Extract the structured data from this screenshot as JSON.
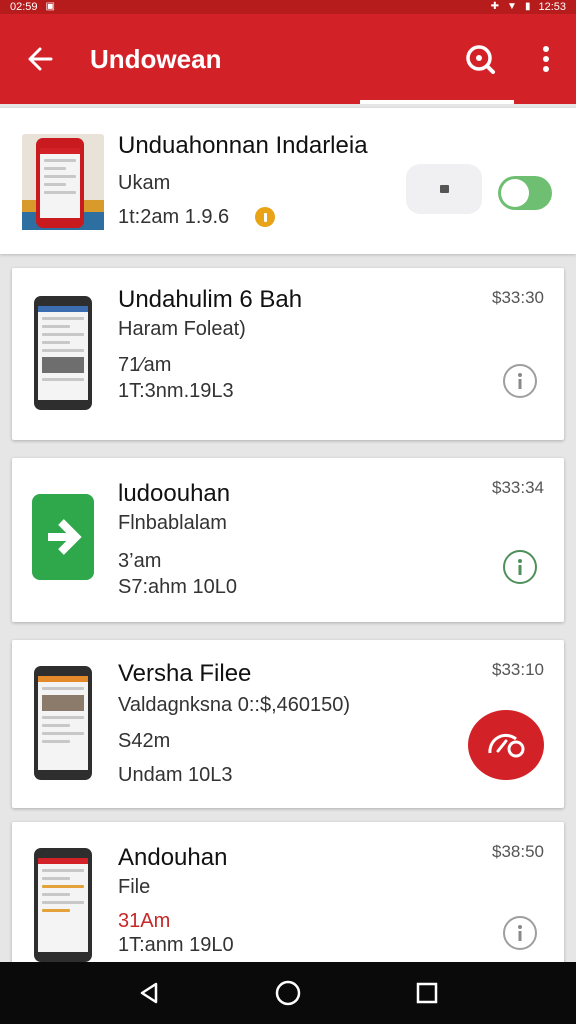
{
  "status_bar": {
    "time_left": "02:59",
    "time_right": "12:53"
  },
  "app_bar": {
    "title": "Undowean"
  },
  "featured": {
    "name": "Unduahonnan Indarleia",
    "subtitle": "Ukam",
    "meta": "1t:2am 1.9.6"
  },
  "items": [
    {
      "name": "Undahulim 6 Bah",
      "subtitle": "Haram Foleat)",
      "size": "71⁄am",
      "meta": "1T:3nm.19L3",
      "price": "$33:30"
    },
    {
      "name": "ludoouhan",
      "subtitle": "Flnbablalam",
      "size": "3’am",
      "meta": "S7:ahm 10L0",
      "price": "$33:34"
    },
    {
      "name": "Versha Filee",
      "subtitle": "Valdagnksna 0::$,460150)",
      "size": "S42m",
      "meta": "Undam 10L3",
      "price": "$33:10"
    },
    {
      "name": "Andouhan",
      "subtitle": "File",
      "size": "31Am",
      "meta": "1T:anm 19L0",
      "price": "$38:50"
    }
  ],
  "colors": {
    "accent": "#d32128",
    "toggle_on": "#6fbf73",
    "status_dot": "#e8a317"
  }
}
